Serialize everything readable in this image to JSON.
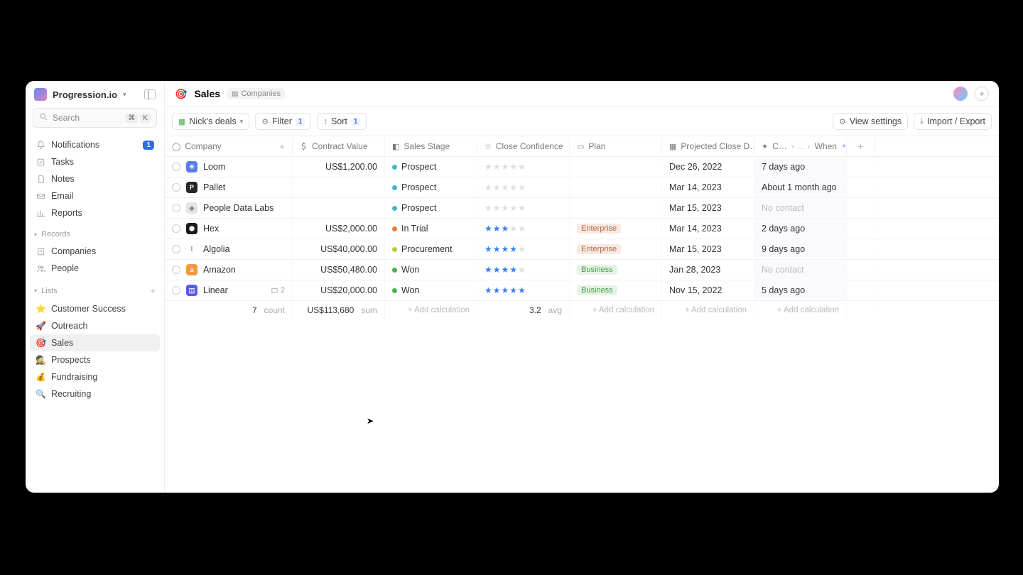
{
  "workspace": {
    "name": "Progression.io"
  },
  "search": {
    "placeholder": "Search",
    "kbd": [
      "⌘",
      "K"
    ]
  },
  "nav": {
    "main": [
      {
        "icon": "bell",
        "label": "Notifications",
        "badge": "1"
      },
      {
        "icon": "check",
        "label": "Tasks"
      },
      {
        "icon": "file",
        "label": "Notes"
      },
      {
        "icon": "mail",
        "label": "Email"
      },
      {
        "icon": "chart",
        "label": "Reports"
      }
    ],
    "records_header": "Records",
    "records": [
      {
        "icon": "building",
        "label": "Companies"
      },
      {
        "icon": "people",
        "label": "People"
      }
    ],
    "lists_header": "Lists",
    "lists": [
      {
        "emoji": "⭐",
        "label": "Customer Success"
      },
      {
        "emoji": "🚀",
        "label": "Outreach"
      },
      {
        "emoji": "🎯",
        "label": "Sales",
        "active": true
      },
      {
        "emoji": "🕵️",
        "label": "Prospects"
      },
      {
        "emoji": "💰",
        "label": "Fundraising"
      },
      {
        "emoji": "🔍",
        "label": "Recruiting"
      }
    ]
  },
  "page": {
    "emoji": "🎯",
    "title": "Sales",
    "tag": "Companies"
  },
  "toolbar": {
    "view_name": "Nick's deals",
    "filter_label": "Filter",
    "filter_count": "1",
    "sort_label": "Sort",
    "sort_count": "1",
    "view_settings": "View settings",
    "import_export": "Import / Export"
  },
  "columns": [
    {
      "icon": "circle",
      "label": "Company",
      "plus": true
    },
    {
      "icon": "dollar",
      "label": "Contract Value"
    },
    {
      "icon": "stage",
      "label": "Sales Stage"
    },
    {
      "icon": "star",
      "label": "Close Confidence"
    },
    {
      "icon": "tag",
      "label": "Plan"
    },
    {
      "icon": "cal",
      "label": "Projected Close D…"
    },
    {
      "icon": "spark",
      "label_a": "C…",
      "label_b": "When",
      "sparkle": true
    },
    {
      "add": true
    }
  ],
  "rows": [
    {
      "logo_bg": "#5b7cf0",
      "logo_txt": "✳",
      "company": "Loom",
      "value": "US$1,200.00",
      "stage": "Prospect",
      "stage_color": "#42b8c9",
      "stars": 0,
      "plan": "",
      "date": "Dec 26, 2022",
      "when": "7 days ago"
    },
    {
      "logo_bg": "#2a241f",
      "logo_txt": "P",
      "company": "Pallet",
      "value": "",
      "stage": "Prospect",
      "stage_color": "#42b8c9",
      "stars": 0,
      "plan": "",
      "date": "Mar 14, 2023",
      "when": "About 1 month ago"
    },
    {
      "logo_bg": "#e8e4db",
      "logo_txt": "◈",
      "logo_fg": "#888",
      "company": "People Data Labs",
      "value": "",
      "stage": "Prospect",
      "stage_color": "#42b8c9",
      "stars": 0,
      "plan": "",
      "date": "Mar 15, 2023",
      "when": "No contact",
      "when_muted": true
    },
    {
      "logo_bg": "#1a1a1a",
      "logo_txt": "⬢",
      "company": "Hex",
      "value": "US$2,000.00",
      "stage": "In Trial",
      "stage_color": "#e07a3b",
      "stars": 3,
      "plan": "Enterprise",
      "plan_type": "ent",
      "date": "Mar 14, 2023",
      "when": "2 days ago"
    },
    {
      "logo_bg": "#fff",
      "logo_txt": "⦚",
      "logo_fg": "#4a7de0",
      "company": "Algolia",
      "value": "US$40,000.00",
      "stage": "Procurement",
      "stage_color": "#b8ca3e",
      "stars": 4,
      "plan": "Enterprise",
      "plan_type": "ent",
      "date": "Mar 15, 2023",
      "when": "9 days ago"
    },
    {
      "logo_bg": "#f29b3a",
      "logo_txt": "a",
      "company": "Amazon",
      "value": "US$50,480.00",
      "stage": "Won",
      "stage_color": "#4caf50",
      "stars": 4,
      "plan": "Business",
      "plan_type": "bus",
      "date": "Jan 28, 2023",
      "when": "No contact",
      "when_muted": true
    },
    {
      "logo_bg": "#5b5be0",
      "logo_txt": "◫",
      "company": "Linear",
      "comments": "2",
      "value": "US$20,000.00",
      "stage": "Won",
      "stage_color": "#4caf50",
      "stars": 5,
      "plan": "Business",
      "plan_type": "bus",
      "date": "Nov 15, 2022",
      "when": "5 days ago"
    }
  ],
  "footer": {
    "count_num": "7",
    "count_lbl": "count",
    "sum_num": "US$113,680",
    "sum_lbl": "sum",
    "avg_num": "3.2",
    "avg_lbl": "avg",
    "add_calc": "+ Add calculation"
  }
}
